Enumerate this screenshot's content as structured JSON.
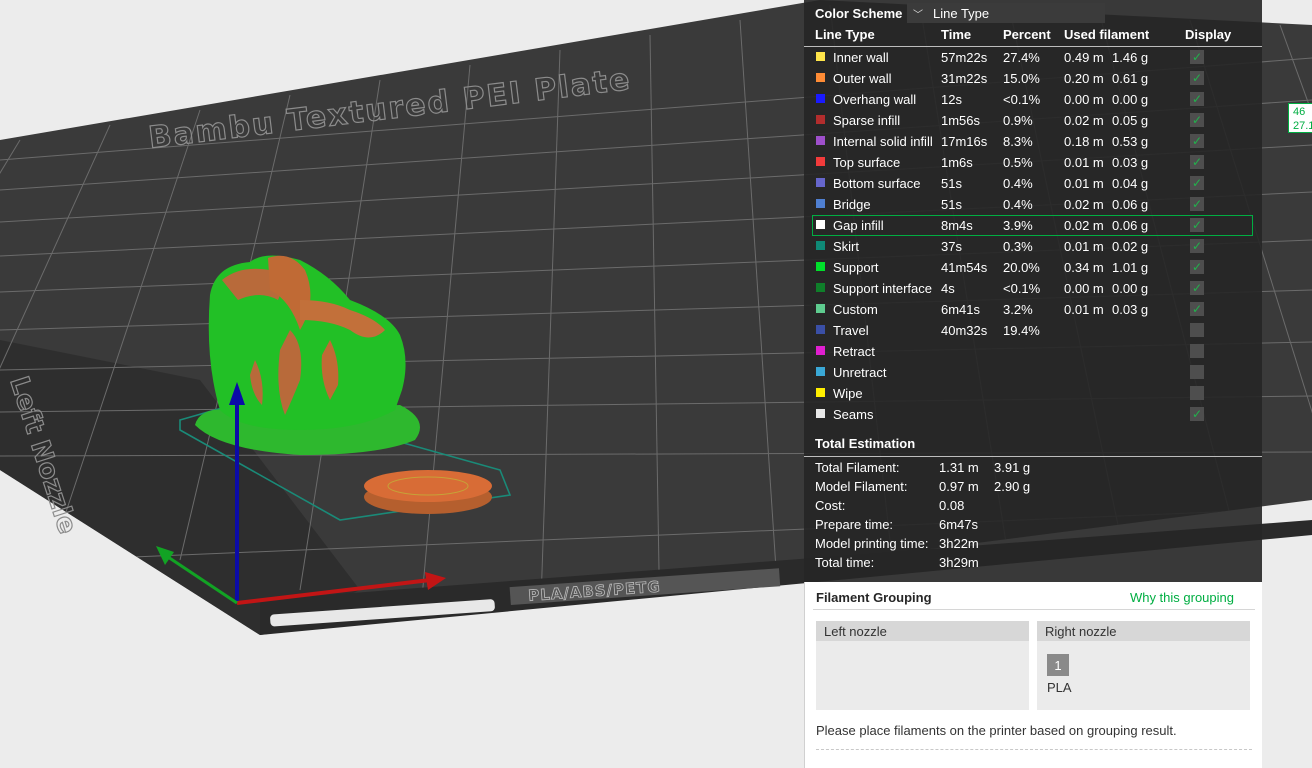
{
  "viewport": {
    "bed_name": "Bambu Textured PEI Plate",
    "bed_side_label": "Left Nozzle",
    "bed_tag": "PLA/ABS/PETG"
  },
  "edge_tag": {
    "line1": "46",
    "line2": "27.1"
  },
  "legend": {
    "color_scheme_label": "Color Scheme",
    "color_scheme_value": "Line Type",
    "headers": {
      "line_type": "Line Type",
      "time": "Time",
      "percent": "Percent",
      "used_filament": "Used filament",
      "display": "Display"
    },
    "rows": [
      {
        "name": "Inner wall",
        "color": "#ffe54a",
        "time": "57m22s",
        "percent": "27.4%",
        "length": "0.49 m",
        "weight": "1.46 g",
        "display": true
      },
      {
        "name": "Outer wall",
        "color": "#ff8c35",
        "time": "31m22s",
        "percent": "15.0%",
        "length": "0.20 m",
        "weight": "0.61 g",
        "display": true
      },
      {
        "name": "Overhang wall",
        "color": "#1a1aff",
        "time": "12s",
        "percent": "<0.1%",
        "length": "0.00 m",
        "weight": "0.00 g",
        "display": true
      },
      {
        "name": "Sparse infill",
        "color": "#b22d2d",
        "time": "1m56s",
        "percent": "0.9%",
        "length": "0.02 m",
        "weight": "0.05 g",
        "display": true
      },
      {
        "name": "Internal solid infill",
        "color": "#9e4fcb",
        "time": "17m16s",
        "percent": "8.3%",
        "length": "0.18 m",
        "weight": "0.53 g",
        "display": true
      },
      {
        "name": "Top surface",
        "color": "#f23b3b",
        "time": "1m6s",
        "percent": "0.5%",
        "length": "0.01 m",
        "weight": "0.03 g",
        "display": true
      },
      {
        "name": "Bottom surface",
        "color": "#6666cc",
        "time": "51s",
        "percent": "0.4%",
        "length": "0.01 m",
        "weight": "0.04 g",
        "display": true
      },
      {
        "name": "Bridge",
        "color": "#4f7fd1",
        "time": "51s",
        "percent": "0.4%",
        "length": "0.02 m",
        "weight": "0.06 g",
        "display": true
      },
      {
        "name": "Gap infill",
        "color": "#ffffff",
        "time": "8m4s",
        "percent": "3.9%",
        "length": "0.02 m",
        "weight": "0.06 g",
        "display": true,
        "highlight": true
      },
      {
        "name": "Skirt",
        "color": "#0f8a77",
        "time": "37s",
        "percent": "0.3%",
        "length": "0.01 m",
        "weight": "0.02 g",
        "display": true
      },
      {
        "name": "Support",
        "color": "#00e02b",
        "time": "41m54s",
        "percent": "20.0%",
        "length": "0.34 m",
        "weight": "1.01 g",
        "display": true
      },
      {
        "name": "Support interface",
        "color": "#0f7f2a",
        "time": "4s",
        "percent": "<0.1%",
        "length": "0.00 m",
        "weight": "0.00 g",
        "display": true
      },
      {
        "name": "Custom",
        "color": "#5ecc8f",
        "time": "6m41s",
        "percent": "3.2%",
        "length": "0.01 m",
        "weight": "0.03 g",
        "display": true
      },
      {
        "name": "Travel",
        "color": "#3a4fa6",
        "time": "40m32s",
        "percent": "19.4%",
        "length": "",
        "weight": "",
        "display": false
      },
      {
        "name": "Retract",
        "color": "#e01fd0",
        "time": "",
        "percent": "",
        "length": "",
        "weight": "",
        "display": false
      },
      {
        "name": "Unretract",
        "color": "#3aa8d6",
        "time": "",
        "percent": "",
        "length": "",
        "weight": "",
        "display": false
      },
      {
        "name": "Wipe",
        "color": "#ffee00",
        "time": "",
        "percent": "",
        "length": "",
        "weight": "",
        "display": false
      },
      {
        "name": "Seams",
        "color": "#e8e8e8",
        "time": "",
        "percent": "",
        "length": "",
        "weight": "",
        "display": true
      }
    ],
    "total_estimation": {
      "title": "Total Estimation",
      "rows": [
        {
          "label": "Total Filament:",
          "value": "1.31 m",
          "value2": "3.91 g"
        },
        {
          "label": "Model Filament:",
          "value": "0.97 m",
          "value2": "2.90 g"
        },
        {
          "label": "Cost:",
          "value": "0.08",
          "value2": ""
        },
        {
          "label": "Prepare time:",
          "value": "6m47s",
          "value2": ""
        },
        {
          "label": "Model printing time:",
          "value": "3h22m",
          "value2": ""
        },
        {
          "label": "Total time:",
          "value": "3h29m",
          "value2": ""
        }
      ]
    }
  },
  "grouping": {
    "title": "Filament Grouping",
    "why_link": "Why this grouping",
    "left_nozzle": "Left nozzle",
    "right_nozzle": "Right nozzle",
    "filament_id": "1",
    "filament_type": "PLA",
    "note": "Please place filaments on the printer based on grouping result."
  }
}
